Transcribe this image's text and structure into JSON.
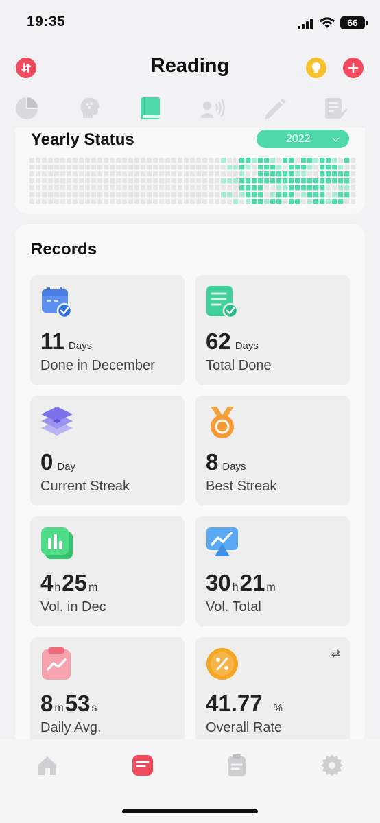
{
  "status_bar": {
    "time": "19:35",
    "battery": "66"
  },
  "header": {
    "title": "Reading"
  },
  "tabs": [
    {
      "icon": "pie-chart-icon"
    },
    {
      "icon": "head-stats-icon"
    },
    {
      "icon": "book-icon",
      "active": true
    },
    {
      "icon": "speaker-icon"
    },
    {
      "icon": "pencil-icon"
    },
    {
      "icon": "checklist-icon"
    }
  ],
  "yearly": {
    "title": "Yearly Status",
    "year": "2022"
  },
  "records": {
    "title": "Records",
    "tiles": [
      {
        "icon": "calendar-check-icon",
        "value": "11",
        "unit": "Days",
        "label": "Done in December"
      },
      {
        "icon": "document-check-icon",
        "value": "62",
        "unit": "Days",
        "label": "Total Done"
      },
      {
        "icon": "layers-icon",
        "value": "0",
        "unit": "Day",
        "label": "Current Streak"
      },
      {
        "icon": "medal-icon",
        "value": "8",
        "unit": "Days",
        "label": "Best Streak"
      },
      {
        "icon": "bar-chart-icon",
        "hours": "4",
        "h_unit": "h",
        "minutes": "25",
        "m_unit": "m",
        "label": "Vol. in Dec"
      },
      {
        "icon": "trend-screen-icon",
        "hours": "30",
        "h_unit": "h",
        "minutes": "21",
        "m_unit": "m",
        "label": "Vol. Total"
      },
      {
        "icon": "clipboard-trend-icon",
        "minutes": "8",
        "m_unit": "m",
        "seconds": "53",
        "s_unit": "s",
        "label": "Daily Avg."
      },
      {
        "icon": "percent-coin-icon",
        "value": "41.77",
        "unit": "%",
        "label": "Overall Rate"
      }
    ]
  },
  "colors": {
    "accent_green": "#4fd8aa",
    "accent_red": "#f04a5e",
    "accent_yellow": "#f6c12e"
  },
  "bottom_nav": [
    {
      "icon": "home-icon"
    },
    {
      "icon": "note-icon",
      "active": true
    },
    {
      "icon": "clipboard-icon"
    },
    {
      "icon": "settings-icon"
    }
  ]
}
